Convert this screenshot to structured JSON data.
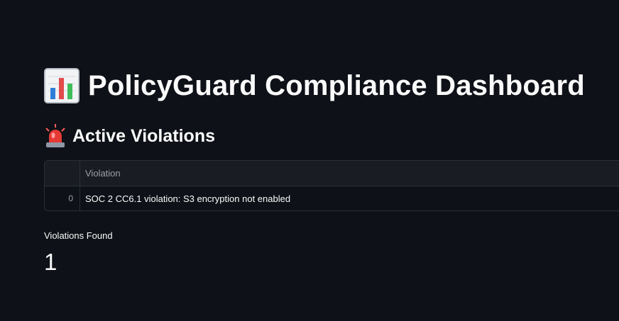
{
  "header": {
    "title": "PolicyGuard Compliance Dashboard",
    "title_icon": "bar-chart-icon"
  },
  "violations_section": {
    "heading": "Active Violations",
    "heading_icon": "siren-icon",
    "table": {
      "columns": [
        "",
        "Violation"
      ],
      "rows": [
        {
          "index": "0",
          "violation": "SOC 2 CC6.1 violation: S3 encryption not enabled"
        }
      ]
    }
  },
  "metric": {
    "label": "Violations Found",
    "value": "1"
  },
  "colors": {
    "background": "#0e1117",
    "text": "#fafafa",
    "muted_text": "#9ca0aa",
    "table_border": "#2b2f3a",
    "table_header_bg": "#1a1c24"
  }
}
